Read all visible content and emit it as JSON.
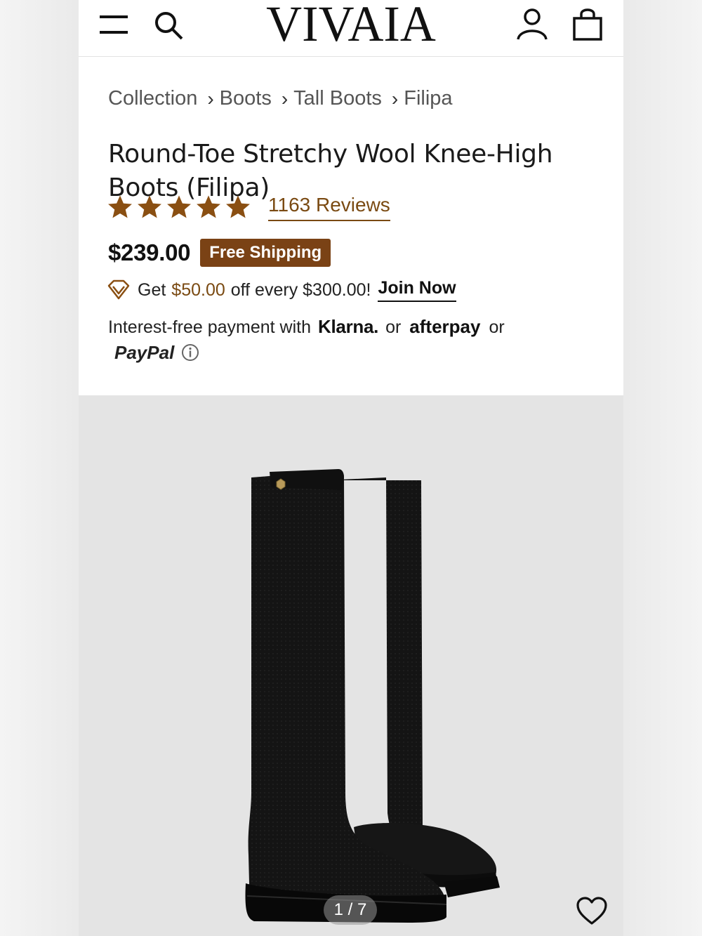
{
  "header": {
    "logo": "VIVAIA",
    "icons": [
      "menu-icon",
      "search-icon",
      "account-icon",
      "shopping-bag-icon"
    ]
  },
  "breadcrumb": [
    "Collection",
    "Boots",
    "Tall Boots",
    "Filipa"
  ],
  "breadcrumb_separator": "›",
  "product": {
    "title": "Round-Toe Stretchy Wool Knee-High Boots (Filipa)",
    "rating": 5,
    "reviews_label": "1163 Reviews",
    "price": "$239.00",
    "shipping_badge": "Free Shipping"
  },
  "promo": {
    "prefix": "Get",
    "amount": "$50.00",
    "suffix": "off every $300.00!",
    "link": "Join Now"
  },
  "payment": {
    "prefix": "Interest-free payment with",
    "provider_1": "Klarna.",
    "or_1": "or",
    "provider_2": "afterpay",
    "or_2": "or",
    "provider_3": "PayPal"
  },
  "gallery": {
    "counter": "1 / 7"
  },
  "colors": {
    "accent_brown": "#7a4215",
    "star": "#8a4f12",
    "link_brown": "#7a4a12",
    "gallery_bg": "#e4e4e4"
  }
}
